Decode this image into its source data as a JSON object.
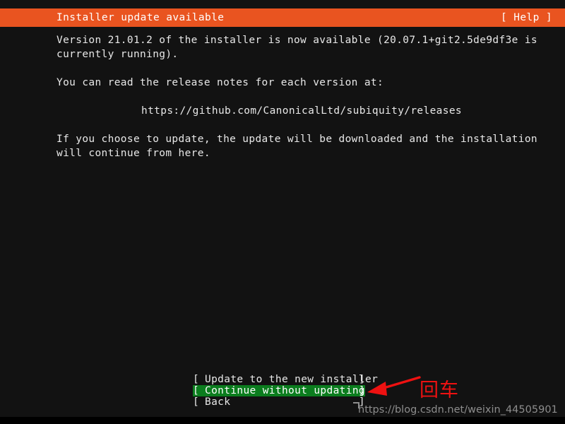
{
  "header": {
    "title": "Installer update available",
    "help_label": "[ Help ]",
    "background_color": "#e95420",
    "text_color": "#ffffff"
  },
  "screen": {
    "background_color": "#121212",
    "text_color": "#e8e8e8"
  },
  "body": {
    "lines": [
      "Version 21.01.2 of the installer is now available (20.07.1+git2.5de9df3e is",
      "currently running).",
      "",
      "You can read the release notes for each version at:",
      "",
      "https://github.com/CanonicalLtd/subiquity/releases",
      "",
      "If you choose to update, the update will be downloaded and the installation",
      "will continue from here."
    ],
    "release_notes_url": "https://github.com/CanonicalLtd/subiquity/releases",
    "available_version": "21.01.2",
    "running_version": "20.07.1+git2.5de9df3e"
  },
  "menu": {
    "bracket_left": "[",
    "bracket_right": "]",
    "selected_index": 1,
    "highlight_color": "#0b7d1e",
    "items": [
      {
        "label": "Update to the new installer",
        "selected": false
      },
      {
        "label": "Continue without updating",
        "selected": true
      },
      {
        "label": "Back",
        "selected": false
      }
    ]
  },
  "annotations": {
    "arrow_color": "#ee1111",
    "enter_text": "回车",
    "enter_text_color": "#ee1111",
    "watermark": "https://blog.csdn.net/weixin_44505901",
    "watermark_color": "#8d8d8d"
  }
}
